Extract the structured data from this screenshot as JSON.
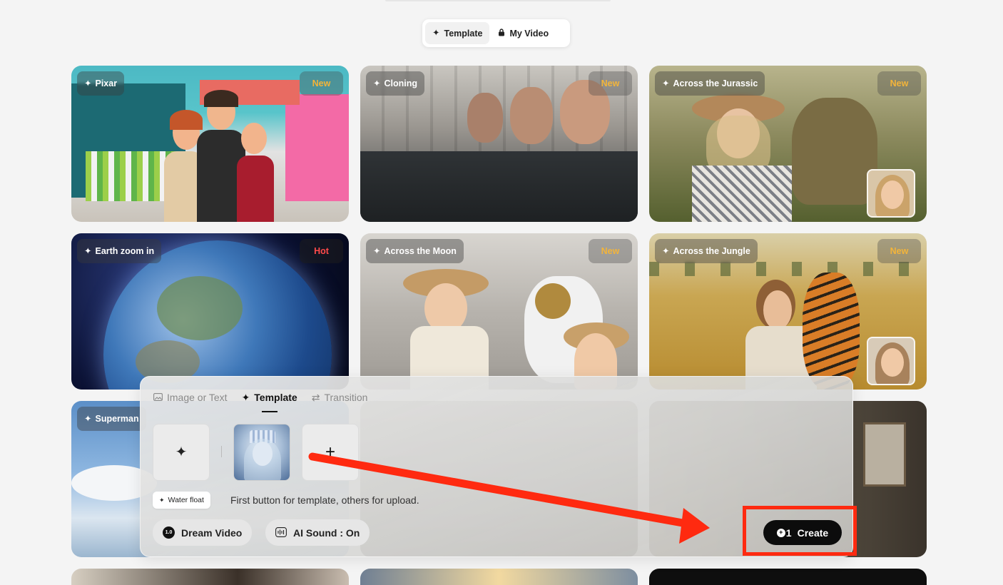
{
  "mode_switch": {
    "template_label": "Template",
    "my_video_label": "My Video"
  },
  "cards": [
    {
      "title": "Pixar",
      "badge": "New"
    },
    {
      "title": "Cloning",
      "badge": "New"
    },
    {
      "title": "Across the Jurassic",
      "badge": "New"
    },
    {
      "title": "Earth zoom in",
      "badge": "Hot"
    },
    {
      "title": "Across the Moon",
      "badge": "New"
    },
    {
      "title": "Across the Jungle",
      "badge": "New"
    },
    {
      "title": "Superman",
      "badge": ""
    }
  ],
  "panel": {
    "tabs": [
      {
        "label": "Image or Text",
        "icon": "image-icon"
      },
      {
        "label": "Template",
        "icon": "sparkle-icon"
      },
      {
        "label": "Transition",
        "icon": "transition-icon"
      }
    ],
    "active_tab": "Template",
    "template_chip": "Water float",
    "hint": "First button for template, others for upload.",
    "model_button": "Dream Video",
    "model_version": "1.0",
    "sound_button": "AI Sound : On",
    "create_cost": "1",
    "create_label": "Create"
  },
  "colors": {
    "new_badge": "#f3b43a",
    "hot_badge": "#ff4a4a",
    "annotation": "#ff2a10"
  }
}
